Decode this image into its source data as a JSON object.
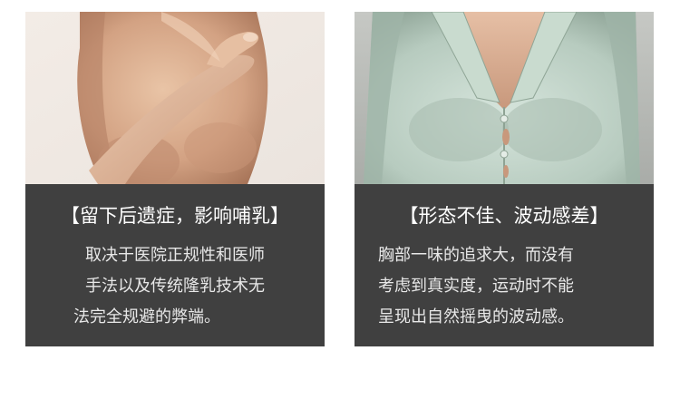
{
  "cards": [
    {
      "title": "【留下后遗症，影响哺乳】",
      "lines": [
        "取决于医院正规性和医师",
        "手法以及传统隆乳技术无",
        "法完全规避的弊端。"
      ]
    },
    {
      "title": "【形态不佳、波动感差】",
      "lines": [
        "胸部一味的追求大，而没有",
        "考虑到真实度，运动时不能",
        "呈现出自然摇曳的波动感。"
      ]
    }
  ],
  "colors": {
    "panel_bg": "#404040",
    "text": "#ffffff"
  }
}
